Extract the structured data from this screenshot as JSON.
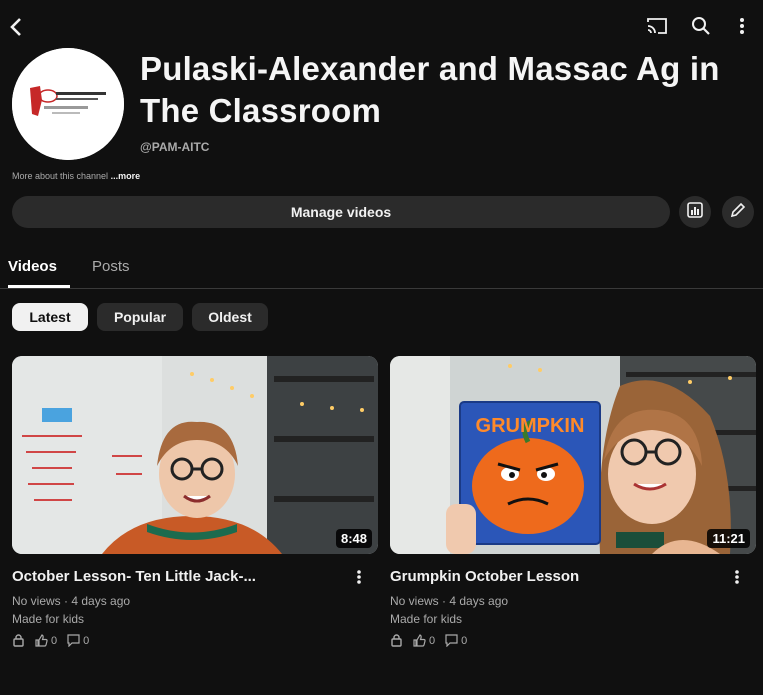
{
  "channel": {
    "title": "Pulaski-Alexander and Massac Ag in The Classroom",
    "handle": "@PAM-AITC",
    "about": "More about this channel",
    "about_more": "...more",
    "manage_label": "Manage videos"
  },
  "tabs": [
    {
      "label": "Videos",
      "selected": true
    },
    {
      "label": "Posts",
      "selected": false
    }
  ],
  "chips": [
    {
      "label": "Latest",
      "selected": true
    },
    {
      "label": "Popular",
      "selected": false
    },
    {
      "label": "Oldest",
      "selected": false
    }
  ],
  "videos": [
    {
      "title": "October Lesson- Ten Little Jack-...",
      "duration": "8:48",
      "meta": "No views · 4 days ago",
      "audience": "Made for kids",
      "likes": "0",
      "comments": "0"
    },
    {
      "title": "Grumpkin October Lesson",
      "duration": "11:21",
      "meta": "No views · 4 days ago",
      "audience": "Made for kids",
      "likes": "0",
      "comments": "0",
      "book_title": "GRUMPKIN"
    }
  ],
  "icons": {
    "back": "back-arrow-icon",
    "cast": "cast-icon",
    "search": "search-icon",
    "menu": "more-vert-icon",
    "stats": "analytics-icon",
    "edit": "pencil-icon"
  },
  "colors": {
    "background": "#101010",
    "chip_bg": "#2b2b2b",
    "chip_selected_bg": "#f1f1f1",
    "secondary_text": "#aaaaaa"
  }
}
